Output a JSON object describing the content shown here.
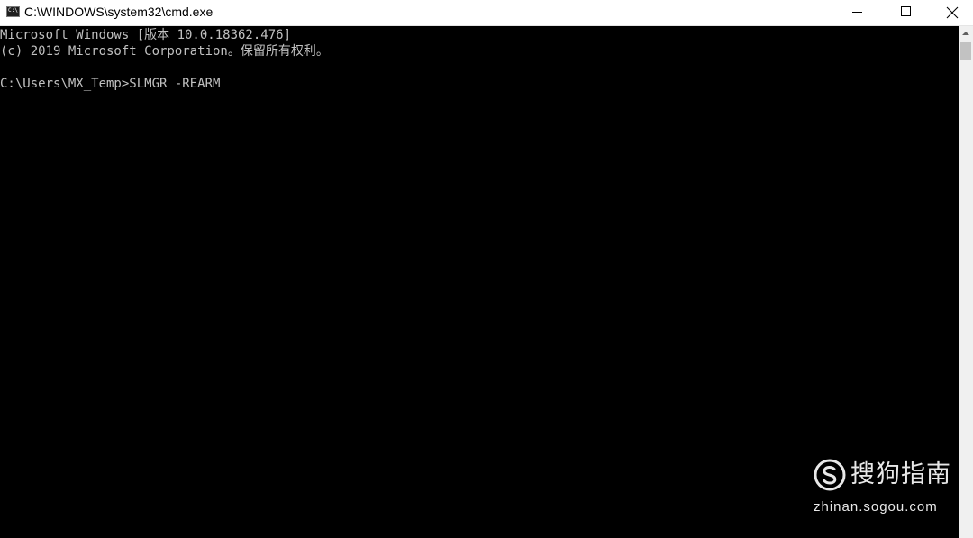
{
  "window": {
    "title": "C:\\WINDOWS\\system32\\cmd.exe",
    "icon": "cmd-icon"
  },
  "console": {
    "lines": [
      "Microsoft Windows [版本 10.0.18362.476]",
      "(c) 2019 Microsoft Corporation。保留所有权利。",
      "C:\\Users\\MX_Temp>SLMGR -REARM"
    ],
    "text_color": "#c0c0c0",
    "background_color": "#000000"
  },
  "watermark": {
    "brand": "搜狗指南",
    "url": "zhinan.sogou.com"
  }
}
